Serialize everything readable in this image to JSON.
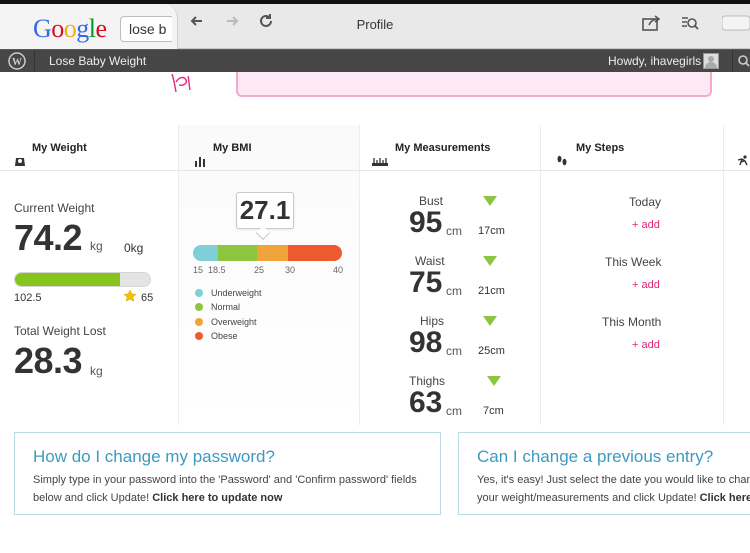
{
  "browser": {
    "logo_letters": [
      "G",
      "o",
      "o",
      "g",
      "l",
      "e"
    ],
    "logo_colors": [
      "#3369e8",
      "#d50f25",
      "#eeb211",
      "#3369e8",
      "#009925",
      "#d50f25"
    ],
    "search_value": "lose b",
    "page_title": "Profile"
  },
  "admin_bar": {
    "site_name": "Lose Baby Weight",
    "howdy": "Howdy, ihavegirls"
  },
  "weight": {
    "title": "My Weight",
    "current_label": "Current Weight",
    "current_value": "74.2",
    "current_unit": "kg",
    "goal_value": "0kg",
    "progress_fraction": 0.78,
    "start_value": "102.5",
    "target_value": "65",
    "lost_label": "Total Weight Lost",
    "lost_value": "28.3",
    "lost_unit": "kg"
  },
  "bmi": {
    "title": "My BMI",
    "value": "27.1",
    "ticks": [
      "15",
      "18.5",
      "25",
      "30",
      "40"
    ],
    "legend": [
      {
        "label": "Underweight",
        "color": "#7ecfd8"
      },
      {
        "label": "Normal",
        "color": "#8cc63f"
      },
      {
        "label": "Overweight",
        "color": "#f0a23b"
      },
      {
        "label": "Obese",
        "color": "#ee5a2f"
      }
    ]
  },
  "measurements": {
    "title": "My Measurements",
    "items": [
      {
        "name": "Bust",
        "value": "95",
        "unit": "cm",
        "change": "17cm"
      },
      {
        "name": "Waist",
        "value": "75",
        "unit": "cm",
        "change": "21cm"
      },
      {
        "name": "Hips",
        "value": "98",
        "unit": "cm",
        "change": "25cm"
      },
      {
        "name": "Thighs",
        "value": "63",
        "unit": "cm",
        "change": "7cm"
      }
    ]
  },
  "steps": {
    "title": "My Steps",
    "periods": [
      {
        "label": "Today",
        "add": "+ add"
      },
      {
        "label": "This Week",
        "add": "+ add"
      },
      {
        "label": "This Month",
        "add": "+ add"
      }
    ]
  },
  "faq": [
    {
      "title": "How do I change my password?",
      "line1": "Simply type in your password into the 'Password' and 'Confirm password' fields",
      "line2_prefix": "below and click Update! ",
      "line2_link": "Click here to update now"
    },
    {
      "title": "Can I change a previous entry?",
      "line1": "Yes, it's easy! Just select the date you would like to change",
      "line2_prefix": "your weight/measurements and click Update! ",
      "line2_link": "Click here t"
    }
  ]
}
